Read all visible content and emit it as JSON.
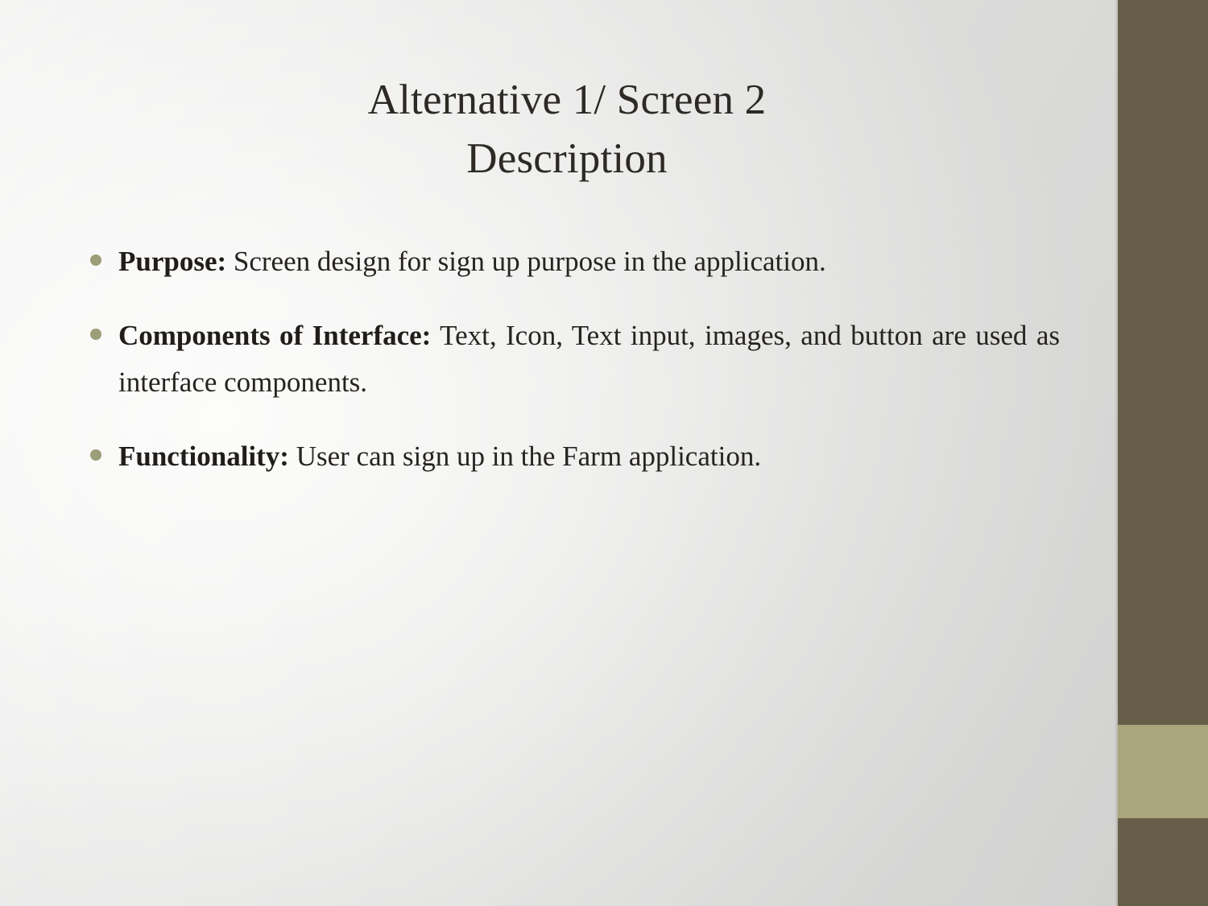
{
  "slide": {
    "title": {
      "line1": "Alternative 1/ Screen 2",
      "line2": "Description"
    },
    "bullets": [
      {
        "label": "Purpose:",
        "text": " Screen design for sign up purpose in the application."
      },
      {
        "label": "Components of Interface:",
        "text": " Text, Icon, Text input, images, and button are used as interface components."
      },
      {
        "label": "Functionality:",
        "text": " User can sign up in the Farm application."
      }
    ]
  },
  "theme": {
    "bullet_color": "#9b9e78",
    "sidebar_dark": "#665e49",
    "sidebar_light": "#a9a67d",
    "title_color": "#2d2a26",
    "body_color": "#262320",
    "background_light": "#fbfbfa",
    "background_grey": "#dcdcdb"
  }
}
